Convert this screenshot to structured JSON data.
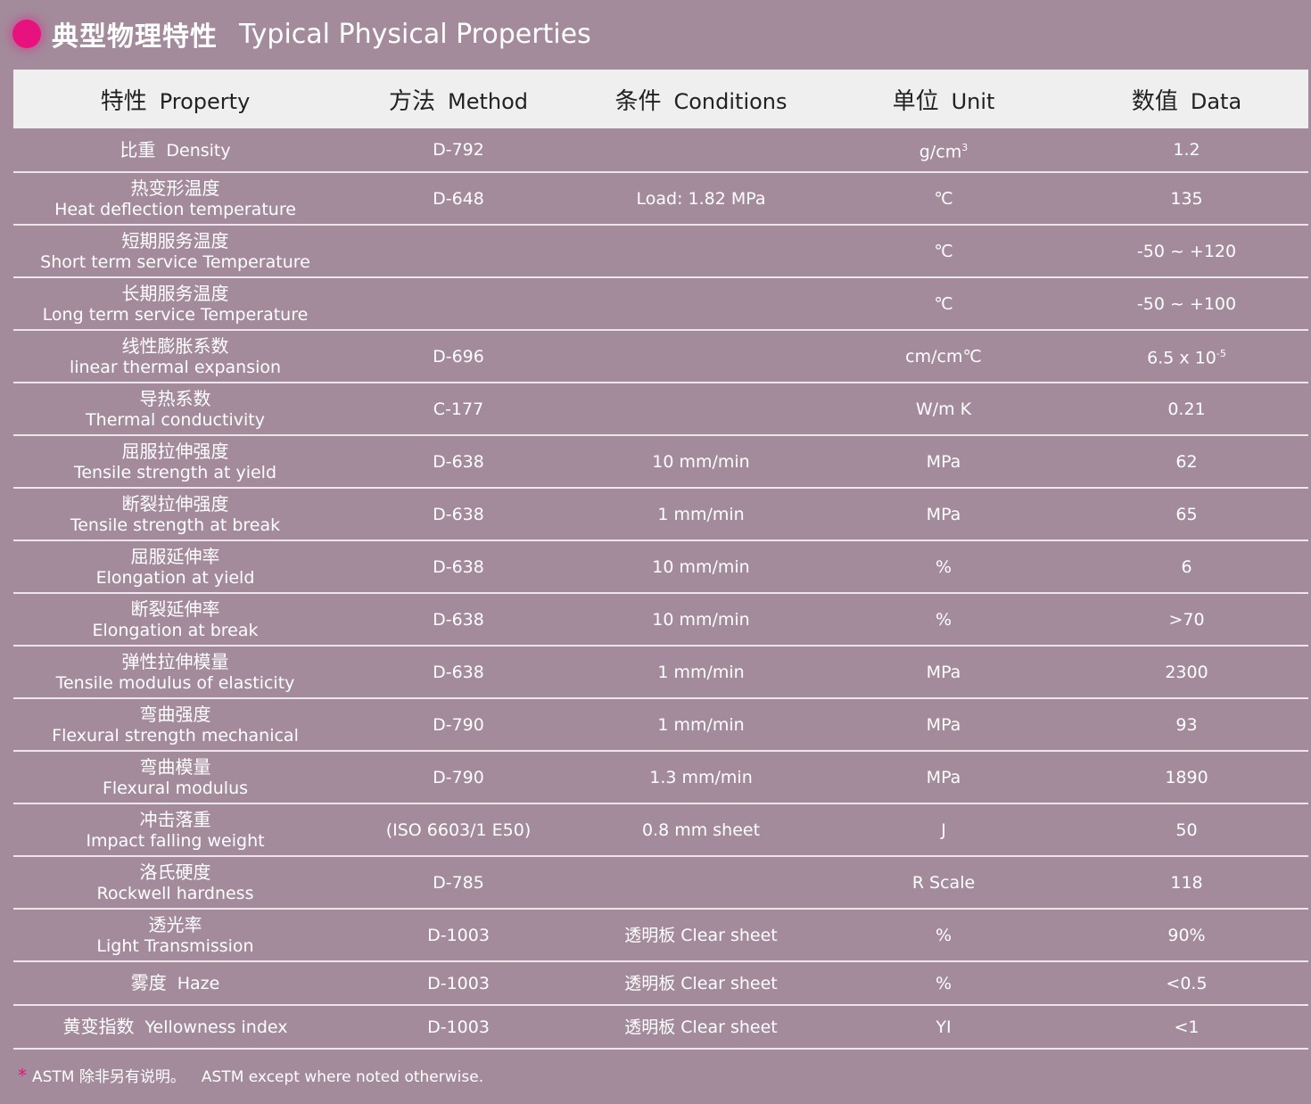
{
  "header": {
    "title_cn": "典型物理特性",
    "title_en": "Typical Physical Properties",
    "accent_color": "#e8127f"
  },
  "table": {
    "columns": [
      {
        "cn": "特性",
        "en": "Property"
      },
      {
        "cn": "方法",
        "en": "Method"
      },
      {
        "cn": "条件",
        "en": "Conditions"
      },
      {
        "cn": "单位",
        "en": "Unit"
      },
      {
        "cn": "数值",
        "en": "Data"
      }
    ],
    "rows": [
      {
        "cn": "比重",
        "en": "Density",
        "method": "D-792",
        "conditions": "",
        "unit": "g/cm",
        "unit_sup": "3",
        "data": "1.2"
      },
      {
        "cn": "热变形温度",
        "en": "Heat deflection temperature",
        "method": "D-648",
        "conditions": "Load: 1.82 MPa",
        "unit": "℃",
        "data": "135"
      },
      {
        "cn": "短期服务温度",
        "en": "Short term service Temperature",
        "method": "",
        "conditions": "",
        "unit": "℃",
        "data": "-50 ~ +120"
      },
      {
        "cn": "长期服务温度",
        "en": "Long term service Temperature",
        "method": "",
        "conditions": "",
        "unit": "℃",
        "data": "-50 ~ +100"
      },
      {
        "cn": "线性膨胀系数",
        "en": "linear thermal expansion",
        "method": "D-696",
        "conditions": "",
        "unit": "cm/cm℃",
        "data": "6.5 x 10",
        "data_sup": "-5"
      },
      {
        "cn": "导热系数",
        "en": "Thermal conductivity",
        "method": "C-177",
        "conditions": "",
        "unit": "W/m K",
        "data": "0.21"
      },
      {
        "cn": "屈服拉伸强度",
        "en": "Tensile strength at yield",
        "method": "D-638",
        "conditions": "10 mm/min",
        "unit": "MPa",
        "data": "62"
      },
      {
        "cn": "断裂拉伸强度",
        "en": "Tensile strength at break",
        "method": "D-638",
        "conditions": "1 mm/min",
        "unit": "MPa",
        "data": "65"
      },
      {
        "cn": "屈服延伸率",
        "en": "Elongation at yield",
        "method": "D-638",
        "conditions": "10 mm/min",
        "unit": "%",
        "data": "6"
      },
      {
        "cn": "断裂延伸率",
        "en": "Elongation at break",
        "method": "D-638",
        "conditions": "10 mm/min",
        "unit": "%",
        "data": ">70"
      },
      {
        "cn": "弹性拉伸模量",
        "en": "Tensile modulus of elasticity",
        "method": "D-638",
        "conditions": "1 mm/min",
        "unit": "MPa",
        "data": "2300"
      },
      {
        "cn": "弯曲强度",
        "en": "Flexural strength mechanical",
        "method": "D-790",
        "conditions": "1 mm/min",
        "unit": "MPa",
        "data": "93"
      },
      {
        "cn": "弯曲模量",
        "en": "Flexural modulus",
        "method": "D-790",
        "conditions": "1.3 mm/min",
        "unit": "MPa",
        "data": "1890"
      },
      {
        "cn": "冲击落重",
        "en": "Impact falling weight",
        "method": "(ISO 6603/1 E50)",
        "conditions": "0.8 mm sheet",
        "unit": "J",
        "data": "50"
      },
      {
        "cn": "洛氏硬度",
        "en": "Rockwell hardness",
        "method": "D-785",
        "conditions": "",
        "unit": "R Scale",
        "data": "118"
      },
      {
        "cn": "透光率",
        "en": "Light Transmission",
        "method": "D-1003",
        "conditions": "透明板 Clear sheet",
        "unit": "%",
        "data": "90%"
      },
      {
        "cn": "雾度",
        "en": "Haze",
        "method": "D-1003",
        "conditions": "透明板 Clear sheet",
        "unit": "%",
        "data": "<0.5"
      },
      {
        "cn": "黄变指数",
        "en": "Yellowness index",
        "method": "D-1003",
        "conditions": "透明板 Clear sheet",
        "unit": "YI",
        "data": "<1"
      }
    ]
  },
  "footnote": {
    "star": "*",
    "cn": "ASTM 除非另有说明。",
    "en": "ASTM except where noted otherwise."
  }
}
